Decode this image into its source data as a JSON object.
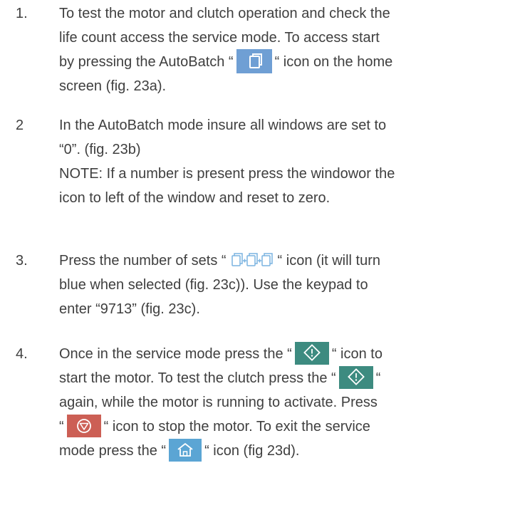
{
  "steps": [
    {
      "number": "1.",
      "lines": {
        "l1": "To test the motor and clutch operation and check the",
        "l2": "life count access the service mode.  To access start",
        "l3a": "by pressing the AutoBatch  “",
        "l3b": "“ icon on the home",
        "l4": "screen (fig. 23a)."
      }
    },
    {
      "number": "2",
      "lines": {
        "l1": "In the AutoBatch mode insure all windows are set to",
        "l2": "“0”. (fig. 23b)",
        "l3": "NOTE: If a number is present press the windowor the",
        "l4": "icon to left of the window and reset to zero."
      }
    },
    {
      "number": "3.",
      "lines": {
        "l1a": "Press the number of sets “",
        "l1b": "“ icon (it will turn",
        "l2": "blue when selected (fig. 23c)). Use the keypad to",
        "l3": "enter “9713” (fig. 23c)."
      }
    },
    {
      "number": "4.",
      "lines": {
        "l1a": "Once in the service mode press the “",
        "l1b": "“ icon to",
        "l2a": "start the motor.  To test the clutch press the “",
        "l2b": "“",
        "l3": "again, while the motor is running to activate. Press",
        "l4a": "“",
        "l4b": "“ icon to stop the motor.  To exit the service",
        "l5a": "mode press the “",
        "l5b": "“ icon (fig 23d)."
      }
    }
  ],
  "icons": {
    "autobatch": "autobatch-icon",
    "sets": "number-of-sets-icon",
    "start": "start-icon",
    "stop": "stop-icon",
    "home": "home-icon"
  },
  "colors": {
    "text": "#3f3f3f",
    "autobatch_bg": "#6f9fd4",
    "sets_fill": "#7ab3e0",
    "start_bg": "#3d8b80",
    "stop_bg": "#cc5f55",
    "home_bg": "#5ba5d4"
  }
}
